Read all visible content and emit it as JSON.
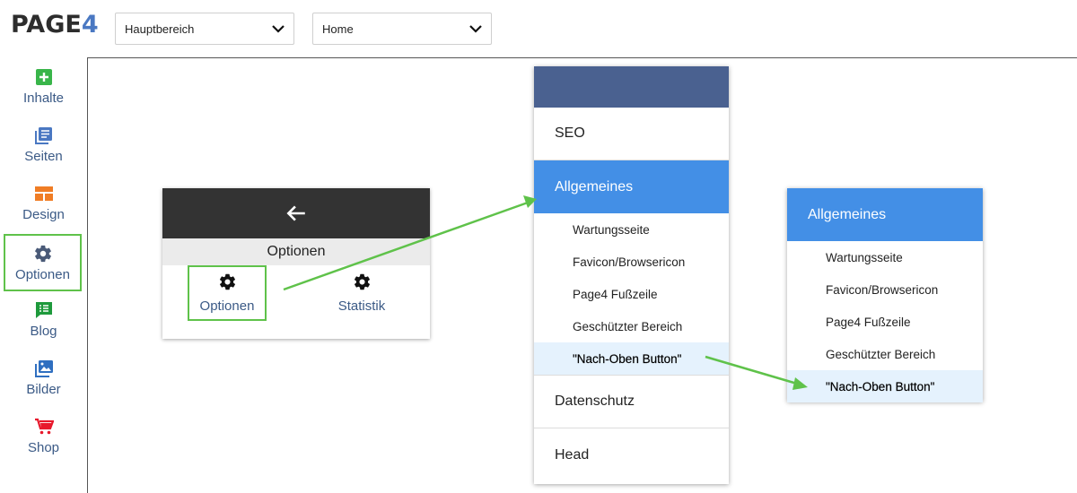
{
  "logo": {
    "text_main": "PAGE",
    "text_num": "4"
  },
  "toolbar": {
    "area_select": "Hauptbereich",
    "page_select": "Home"
  },
  "sidebar": {
    "items": [
      {
        "label": "Inhalte",
        "icon": "plus-square-icon",
        "color": "#39b54a"
      },
      {
        "label": "Seiten",
        "icon": "pages-icon",
        "color": "#4a78c2"
      },
      {
        "label": "Design",
        "icon": "layout-icon",
        "color": "#f07d25"
      },
      {
        "label": "Optionen",
        "icon": "gear-icon",
        "color": "#4a5a78"
      },
      {
        "label": "Blog",
        "icon": "blog-icon",
        "color": "#1e9a3c"
      },
      {
        "label": "Bilder",
        "icon": "images-icon",
        "color": "#2f6fc0"
      },
      {
        "label": "Shop",
        "icon": "cart-icon",
        "color": "#e8192c"
      }
    ]
  },
  "options_card": {
    "title": "Optionen",
    "buttons": [
      {
        "label": "Optionen",
        "icon": "gear-icon"
      },
      {
        "label": "Statistik",
        "icon": "gear-icon"
      }
    ]
  },
  "menu": {
    "items": [
      "SEO",
      "Allgemeines",
      "Datenschutz",
      "Head"
    ],
    "sub_items": [
      "Wartungsseite",
      "Favicon/Browsericon",
      "Page4 Fußzeile",
      "Geschützter Bereich",
      "\"Nach-Oben Button\""
    ]
  },
  "detail": {
    "title": "Allgemeines",
    "sub_items": [
      "Wartungsseite",
      "Favicon/Browsericon",
      "Page4 Fußzeile",
      "Geschützter Bereich",
      "\"Nach-Oben Button\""
    ]
  },
  "colors": {
    "accent_green": "#5fc24a",
    "active_blue": "#438fe6",
    "header_navy": "#4a6190",
    "nav_text": "#3b5a86"
  }
}
